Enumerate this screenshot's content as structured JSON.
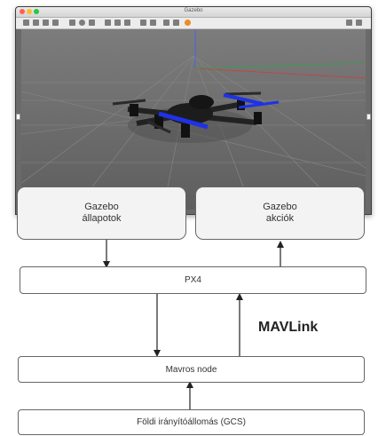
{
  "gazebo_window": {
    "title": "Gazebo",
    "traffic_lights": [
      "#ff5f57",
      "#febc2e",
      "#28c840"
    ],
    "drone_propeller_color": "#1e32e6"
  },
  "boxes": {
    "gazebo_states": {
      "line1": "Gazebo",
      "line2": "állapotok"
    },
    "gazebo_actions": {
      "line1": "Gazebo",
      "line2": "akciók"
    },
    "px4": "PX4",
    "mavros_node": "Mavros node",
    "gcs": "Földi irányítóállomás (GCS)"
  },
  "labels": {
    "mavlink": "MAVLink"
  }
}
